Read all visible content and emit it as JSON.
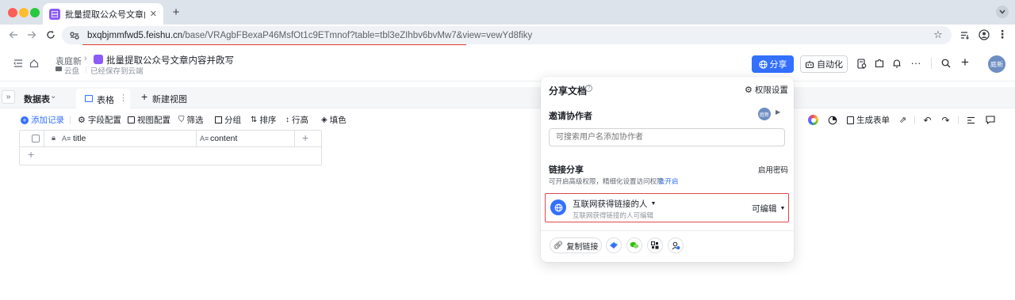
{
  "browser": {
    "tab_title": "批量提取公众号文章内容并改写",
    "url_host": "bxqbjmmfwd5.feishu.cn",
    "url_path": "/base/VRAgbFBexaP46MsfOt1c9ETmnof?table=tbl3eZIhbv6bvMw7&view=vewYd8fiky"
  },
  "header": {
    "owner": "袁庭新",
    "doc_title": "批量提取公众号文章内容并改写",
    "location": "云盘",
    "save_status": "已经保存到云端",
    "share_label": "分享",
    "automation_label": "自动化",
    "avatar_text": "庭新"
  },
  "tabs": {
    "datatable_label": "数据表",
    "grid_view_label": "表格",
    "new_view_label": "新建视图"
  },
  "toolbar": {
    "add_record": "添加记录",
    "field_config": "字段配置",
    "view_config": "视图配置",
    "filter": "筛选",
    "group": "分组",
    "sort": "排序",
    "row_height": "行高",
    "fill": "填色",
    "generate_form": "生成表单"
  },
  "grid": {
    "columns": [
      "title",
      "content"
    ]
  },
  "share_panel": {
    "title": "分享文档",
    "permission_settings": "权限设置",
    "invite_title": "邀请协作者",
    "invite_avatar_text": "庭新",
    "invite_placeholder": "可搜索用户名添加协作者",
    "link_share_title": "链接分享",
    "enable_password": "启用密码",
    "link_desc": "可开启高级权限，精细化设置访问权限",
    "link_desc_action": "去开启",
    "link_scope": "互联网获得链接的人",
    "link_scope_desc": "互联网获得链接的人可编辑",
    "link_permission": "可编辑",
    "copy_link": "复制链接"
  },
  "colors": {
    "accent": "#3370ff",
    "highlight_border": "#e0474c",
    "brand_purple": "#8b5cf6"
  }
}
